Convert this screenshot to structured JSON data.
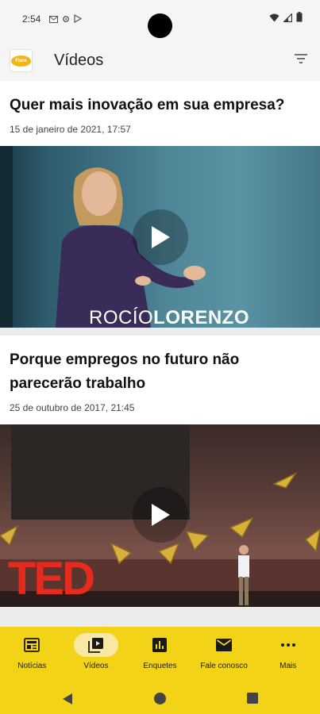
{
  "status_bar": {
    "time": "2:54"
  },
  "app_bar": {
    "logo_text": "Flare",
    "title": "Vídeos",
    "filter_icon": "filter-icon"
  },
  "feed": [
    {
      "title": "Quer mais inovação em sua empresa?",
      "date": "15 de janeiro de 2021, 17:57",
      "thumbnail_caption_first": "ROCÍO",
      "thumbnail_caption_last": "LORENZO"
    },
    {
      "title": "Porque empregos no futuro não parecerão trabalho",
      "date": "25 de outubro de 2017, 21:45",
      "thumbnail_logo": "TED"
    }
  ],
  "bottom_nav": [
    {
      "label": "Notícias",
      "icon": "newspaper-icon",
      "active": false
    },
    {
      "label": "Vídeos",
      "icon": "video-library-icon",
      "active": true
    },
    {
      "label": "Enquetes",
      "icon": "poll-chart-icon",
      "active": false
    },
    {
      "label": "Fale conosco",
      "icon": "mail-icon",
      "active": false
    },
    {
      "label": "Mais",
      "icon": "more-dots-icon",
      "active": false
    }
  ],
  "colors": {
    "accent": "#F2D318",
    "active_pill": "#F7E8A4",
    "app_bar": "#F5F5F5"
  }
}
